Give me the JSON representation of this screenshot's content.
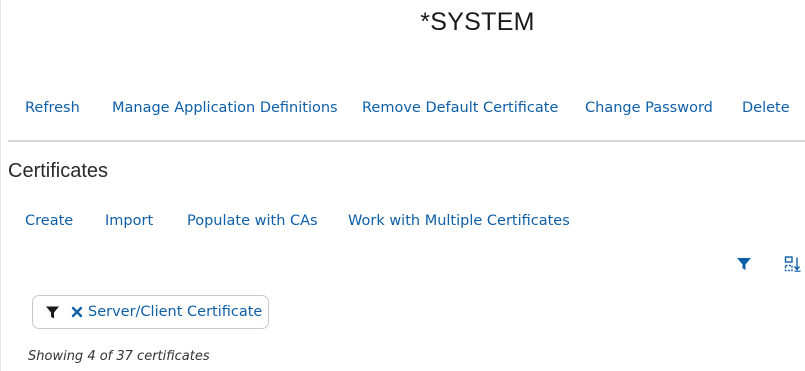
{
  "header": {
    "title": "*SYSTEM"
  },
  "actions": [
    {
      "label": "Refresh"
    },
    {
      "label": "Manage Application Definitions"
    },
    {
      "label": "Remove Default Certificate"
    },
    {
      "label": "Change Password"
    },
    {
      "label": "Delete"
    }
  ],
  "certificates": {
    "heading": "Certificates",
    "actions": [
      {
        "label": "Create"
      },
      {
        "label": "Import"
      },
      {
        "label": "Populate with CAs"
      },
      {
        "label": "Work with Multiple Certificates"
      }
    ],
    "toolbar": {
      "filter_icon": "filter-icon",
      "columns_icon": "sort-columns-icon"
    },
    "filter_chip": {
      "icon": "funnel-icon",
      "remove_icon": "close-icon",
      "label": "Server/Client Certificate"
    },
    "count_text": "Showing 4 of 37 certificates"
  },
  "colors": {
    "link": "#0f5fa8",
    "filter_icon_active": "#0f5fa8",
    "divider": "#d7d7d7"
  }
}
